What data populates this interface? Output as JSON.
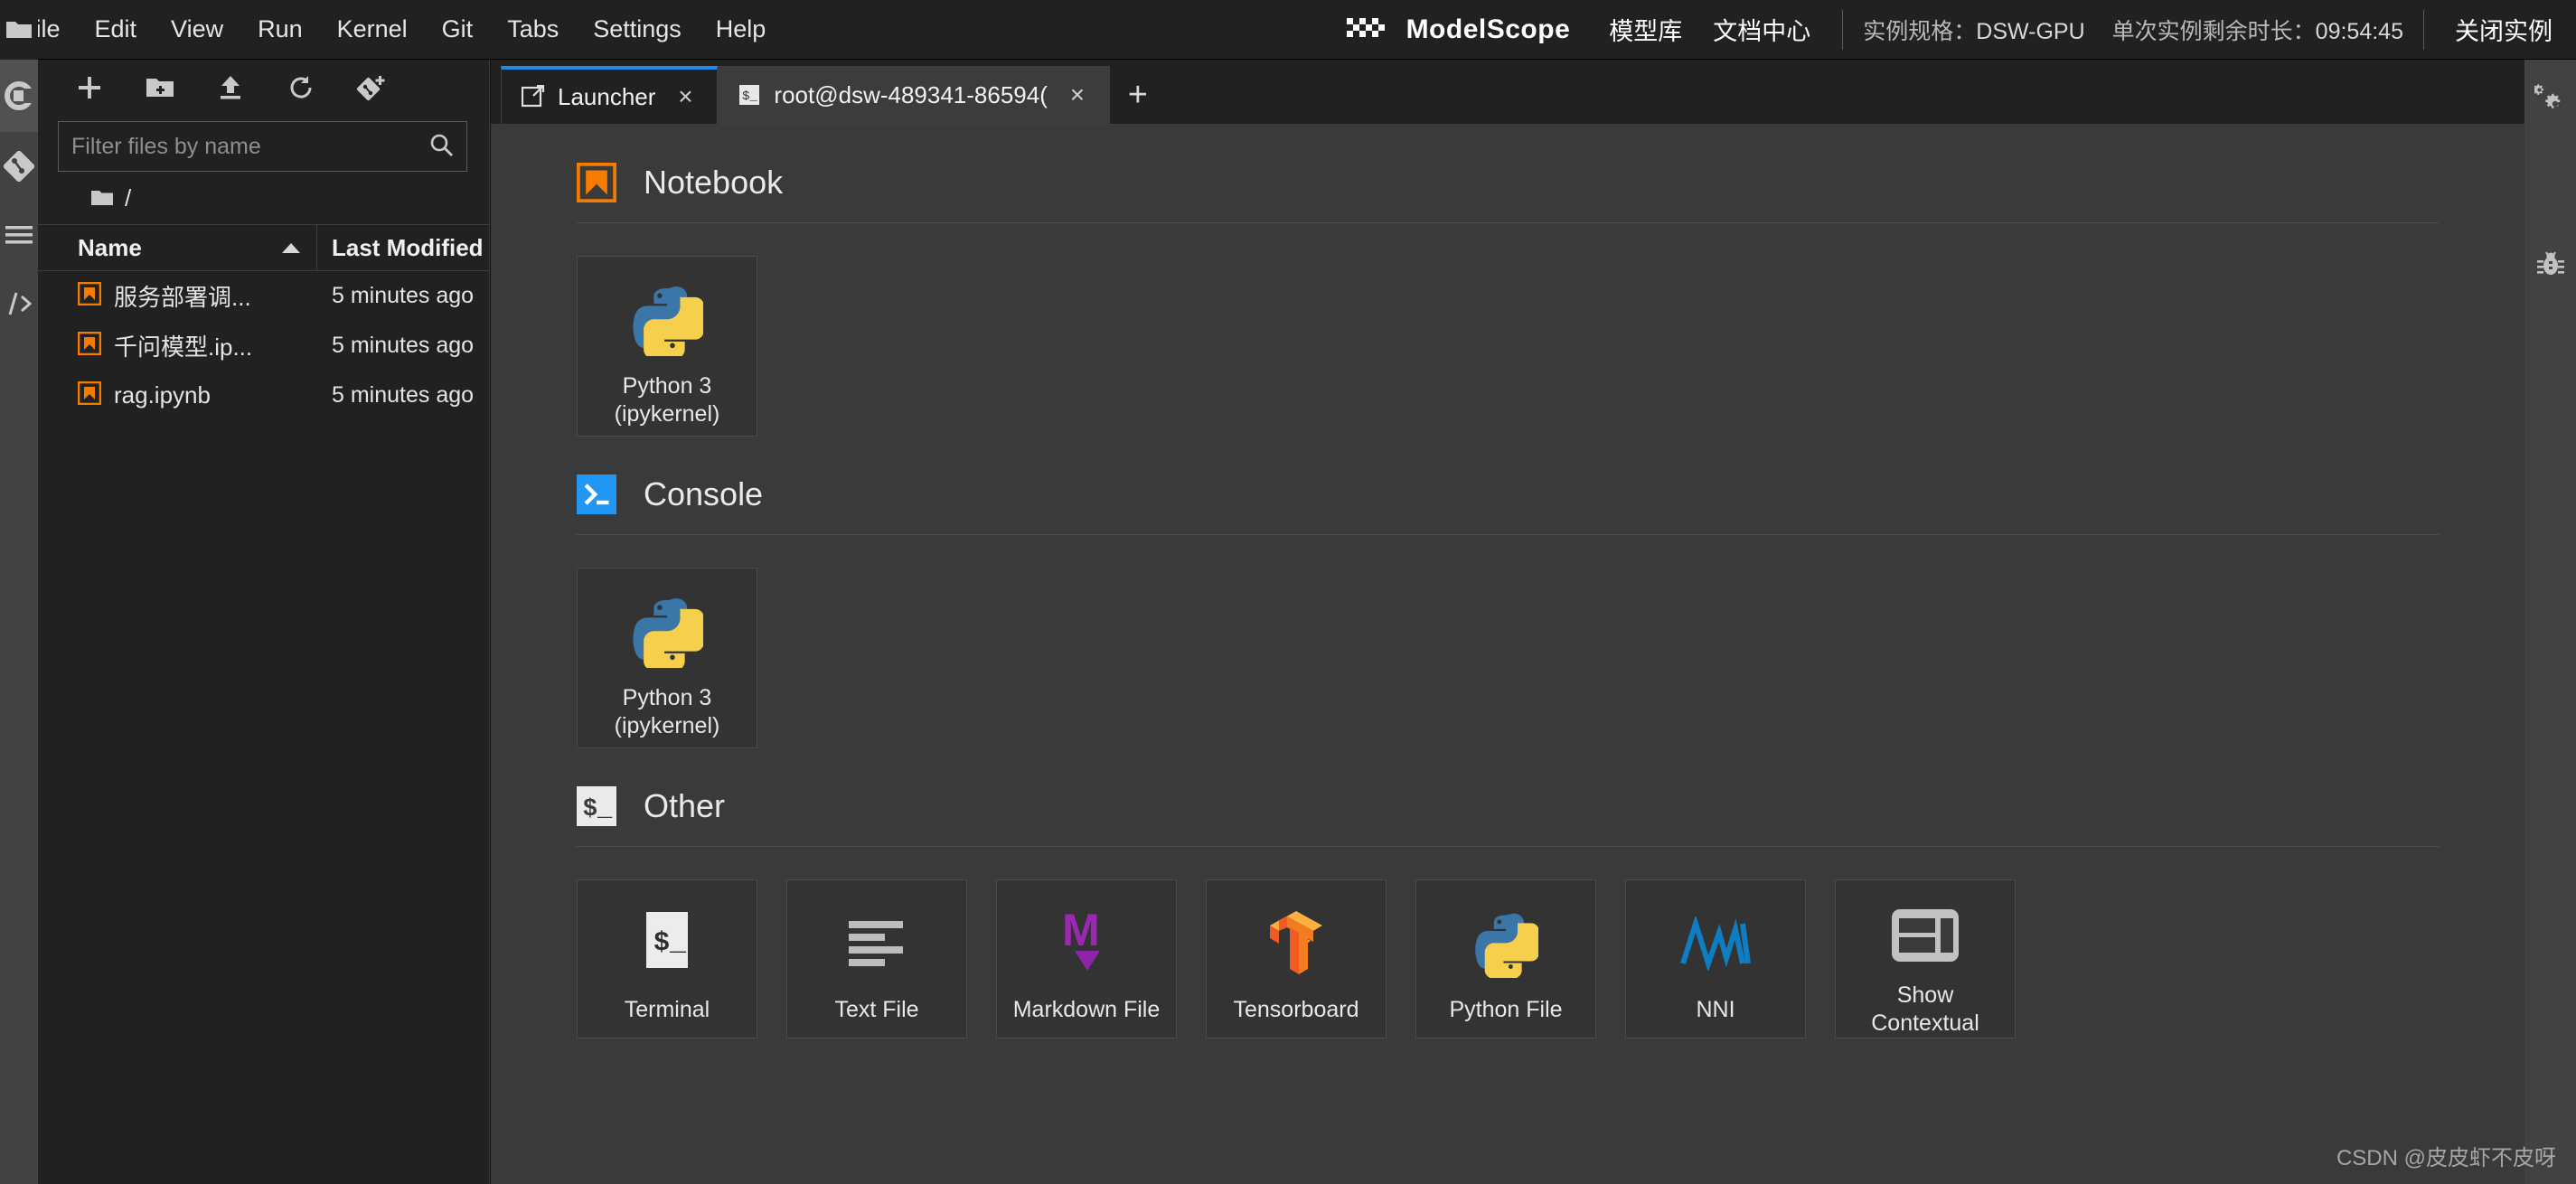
{
  "menubar": {
    "items": [
      {
        "label": "File"
      },
      {
        "label": "Edit"
      },
      {
        "label": "View"
      },
      {
        "label": "Run"
      },
      {
        "label": "Kernel"
      },
      {
        "label": "Git"
      },
      {
        "label": "Tabs"
      },
      {
        "label": "Settings"
      },
      {
        "label": "Help"
      }
    ]
  },
  "topbar_right": {
    "brand": "ModelScope",
    "links": [
      {
        "label": "模型库"
      },
      {
        "label": "文档中心"
      }
    ],
    "instance_spec_label": "实例规格：",
    "instance_spec_value": "DSW-GPU",
    "remaining_label": "单次实例剩余时长：",
    "remaining_value": "09:54:45",
    "close_instance": "关闭实例"
  },
  "activitybar": {
    "items": [
      {
        "name": "file-browser",
        "icon": "folder-icon",
        "active": true
      },
      {
        "name": "running-terminals",
        "icon": "stop-circle-icon",
        "active": false
      },
      {
        "name": "git-panel",
        "icon": "git-icon",
        "active": false
      },
      {
        "name": "table-of-contents",
        "icon": "list-lines-icon",
        "active": false
      },
      {
        "name": "extension-manager",
        "icon": "code-slash-icon",
        "active": false
      }
    ]
  },
  "filebrowser": {
    "toolbar": [
      {
        "name": "new-launcher-button",
        "icon": "plus-icon"
      },
      {
        "name": "new-folder-button",
        "icon": "new-folder-icon"
      },
      {
        "name": "upload-button",
        "icon": "upload-icon"
      },
      {
        "name": "refresh-button",
        "icon": "refresh-icon"
      },
      {
        "name": "git-clone-button",
        "icon": "git-clone-icon"
      }
    ],
    "filter_placeholder": "Filter files by name",
    "filter_value": "",
    "breadcrumb": "/",
    "columns": {
      "name": "Name",
      "last_modified": "Last Modified"
    },
    "sort_direction": "ascending",
    "files": [
      {
        "name": "服务部署调...",
        "modified": "5 minutes ago",
        "icon": "notebook-icon"
      },
      {
        "name": "千问模型.ip...",
        "modified": "5 minutes ago",
        "icon": "notebook-icon"
      },
      {
        "name": "rag.ipynb",
        "modified": "5 minutes ago",
        "icon": "notebook-icon"
      }
    ]
  },
  "tabs": [
    {
      "label": "Launcher",
      "icon": "launcher-icon",
      "active": true,
      "close": "×"
    },
    {
      "label": "root@dsw-489341-86594(",
      "icon": "terminal-icon",
      "active": false,
      "close": "×"
    }
  ],
  "tab_add_label": "+",
  "launcher": {
    "sections": [
      {
        "title": "Notebook",
        "icon": "notebook-icon",
        "cards": [
          {
            "label": "Python 3\n(ipykernel)",
            "icon": "python-logo-icon"
          }
        ]
      },
      {
        "title": "Console",
        "icon": "console-icon",
        "cards": [
          {
            "label": "Python 3\n(ipykernel)",
            "icon": "python-logo-icon"
          }
        ]
      },
      {
        "title": "Other",
        "icon": "other-terminal-icon",
        "cards": [
          {
            "label": "Terminal",
            "icon": "terminal-page-icon"
          },
          {
            "label": "Text File",
            "icon": "text-file-icon"
          },
          {
            "label": "Markdown File",
            "icon": "markdown-icon"
          },
          {
            "label": "Tensorboard",
            "icon": "tensorboard-icon"
          },
          {
            "label": "Python File",
            "icon": "python-file-icon"
          },
          {
            "label": "NNI",
            "icon": "nni-icon"
          },
          {
            "label": "Show Contextual",
            "icon": "contextual-help-icon"
          }
        ]
      }
    ]
  },
  "rightbar": {
    "items": [
      {
        "name": "property-inspector",
        "icon": "gears-icon"
      },
      {
        "name": "debugger",
        "icon": "bug-icon"
      }
    ]
  },
  "watermark": "CSDN @皮皮虾不皮呀",
  "colors": {
    "accent_blue": "#1e8ce8",
    "notebook_orange": "#f57c00",
    "console_blue": "#2196f3",
    "markdown_purple": "#9c27b0",
    "panel_bg": "#212121",
    "launcher_bg": "#3a3a3a"
  }
}
